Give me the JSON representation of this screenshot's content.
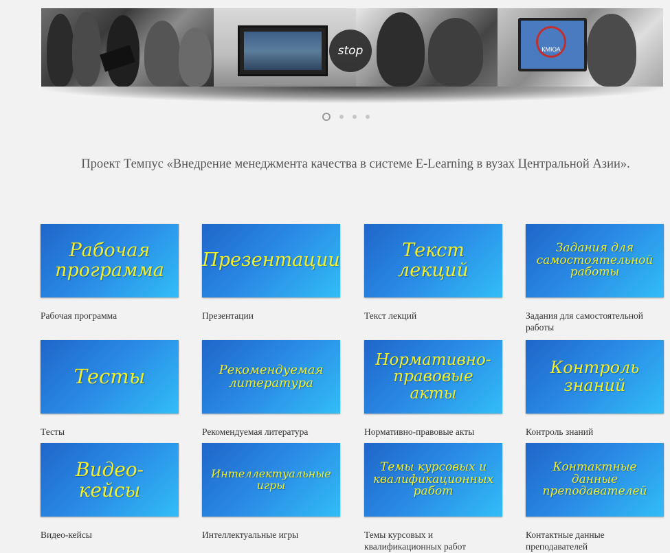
{
  "slider": {
    "stop_label": "stop",
    "monitor_logo": "КМЮА",
    "dot_count": 4,
    "active_dot": 0
  },
  "project": {
    "title": "Проект Темпус «Внедрение менеджмента качества в системе E-Learning в вузах Центральной Азии»."
  },
  "tiles": [
    {
      "banner": "Рабочая программа",
      "caption": "Рабочая программа",
      "size": 27
    },
    {
      "banner": "Презентации",
      "caption": "Презентации",
      "size": 27
    },
    {
      "banner": "Текст лекций",
      "caption": "Текст лекций",
      "size": 27
    },
    {
      "banner": "Задания для самостоятельной работы",
      "caption": "Задания для самостоятельной работы",
      "size": 17
    },
    {
      "banner": "Тесты",
      "caption": "Тесты",
      "size": 29
    },
    {
      "banner": "Рекомендуемая литература",
      "caption": "Рекомендуемая литература",
      "size": 18
    },
    {
      "banner": "Нормативно-правовые акты",
      "caption": "Нормативно-правовые акты",
      "size": 23
    },
    {
      "banner": "Контроль знаний",
      "caption": "Контроль знаний",
      "size": 24
    },
    {
      "banner": "Видео-кейсы",
      "caption": "Видео-кейсы",
      "size": 28
    },
    {
      "banner": "Интеллектуальные игры",
      "caption": "Интеллектуальные игры",
      "size": 16
    },
    {
      "banner": "Темы курсовых и квалификационных работ",
      "caption": "Темы курсовых и квалификационных работ",
      "size": 17
    },
    {
      "banner": "Контактные данные преподавателей",
      "caption": "Контактные данные преподавателей",
      "size": 17
    }
  ],
  "colors": {
    "background": "#f2f2f2",
    "banner_text": "#f3ee2a",
    "banner_start": "#1f66c9",
    "banner_end": "#32bdf7"
  }
}
